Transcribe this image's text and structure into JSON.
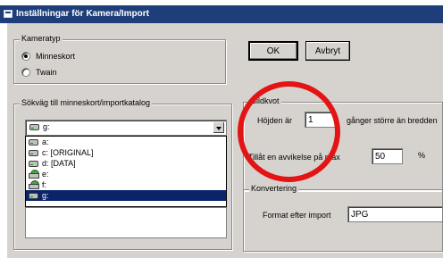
{
  "window": {
    "title": "Inställningar för Kamera/Import"
  },
  "camera_type": {
    "label": "Kameratyp",
    "options": [
      {
        "label": "Minneskort",
        "checked": true
      },
      {
        "label": "Twain",
        "checked": false
      }
    ]
  },
  "buttons": {
    "ok": "OK",
    "cancel": "Avbryt"
  },
  "path": {
    "label": "Sökväg till minneskort/importkatalog",
    "selected": "g:",
    "drives": [
      {
        "label": "a:",
        "icon": "drive-icon",
        "selected": false
      },
      {
        "label": "c: [ORIGINAL]",
        "icon": "drive-icon",
        "selected": false
      },
      {
        "label": "d: [DATA]",
        "icon": "drive-icon",
        "selected": false
      },
      {
        "label": "e:",
        "icon": "network-drive-icon",
        "selected": false
      },
      {
        "label": "f:",
        "icon": "network-drive-icon",
        "selected": false
      },
      {
        "label": "g:",
        "icon": "drive-icon",
        "selected": true
      }
    ]
  },
  "aspect": {
    "label": "Bildkvot",
    "height_prefix": "Höjden är",
    "height_value": "1",
    "height_suffix": "gånger större än bredden",
    "tolerance_label": "Tillåt en avvikelse på max",
    "tolerance_value": "50",
    "tolerance_unit": "%"
  },
  "conversion": {
    "label": "Konvertering",
    "format_label": "Format efter import",
    "format_value": "JPG"
  },
  "annotation": {
    "color": "#e31414"
  }
}
